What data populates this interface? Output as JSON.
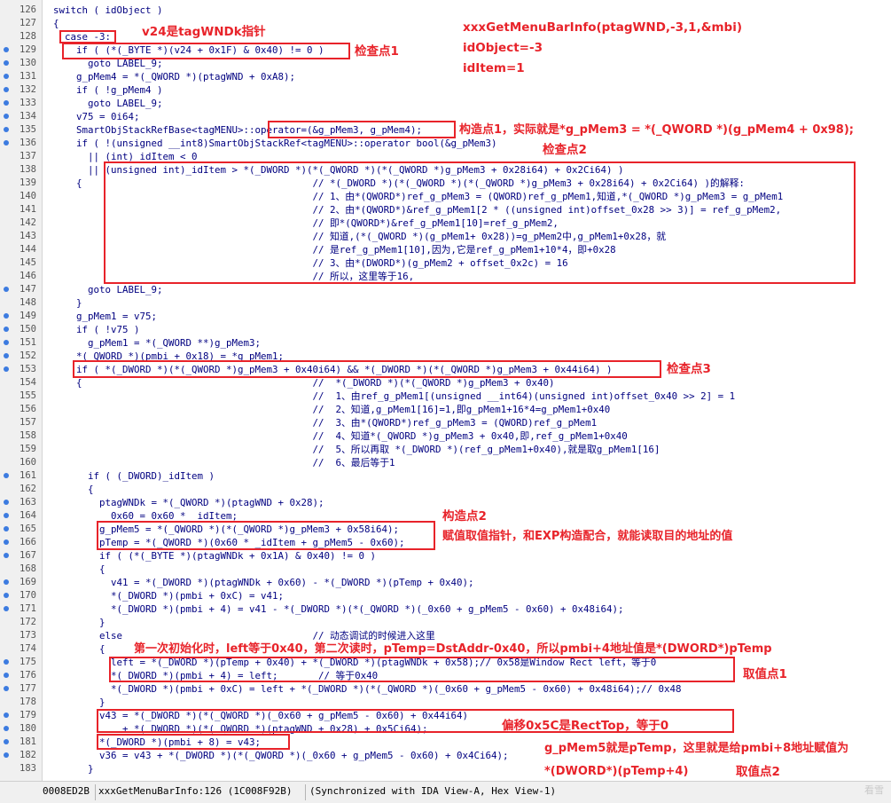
{
  "code_lines": [
    {
      "n": "126",
      "t": "switch ( idObject )"
    },
    {
      "n": "127",
      "t": "{"
    },
    {
      "n": "128",
      "t": "  case -3:"
    },
    {
      "n": "129",
      "dot": true,
      "t": "    if ( (*(_BYTE *)(v24 + 0x1F) & 0x40) != 0 )"
    },
    {
      "n": "130",
      "dot": true,
      "t": "      goto LABEL_9;"
    },
    {
      "n": "131",
      "dot": true,
      "t": "    g_pMem4 = *(_QWORD *)(ptagWND + 0xA8);"
    },
    {
      "n": "132",
      "dot": true,
      "t": "    if ( !g_pMem4 )"
    },
    {
      "n": "133",
      "dot": true,
      "t": "      goto LABEL_9;"
    },
    {
      "n": "134",
      "dot": true,
      "t": "    v75 = 0i64;"
    },
    {
      "n": "135",
      "dot": true,
      "t": "    SmartObjStackRefBase<tagMENU>::operator=(&g_pMem3, g_pMem4);"
    },
    {
      "n": "136",
      "dot": true,
      "t": "    if ( !(unsigned __int8)SmartObjStackRef<tagMENU>::operator bool(&g_pMem3)"
    },
    {
      "n": "137",
      "t": "      || (int)_idItem < 0"
    },
    {
      "n": "138",
      "t": "      || (unsigned int)_idItem > *(_DWORD *)(*(_QWORD *)(*(_QWORD *)g_pMem3 + 0x28i64) + 0x2Ci64) )"
    },
    {
      "n": "139",
      "t": "    {                                        // *(_DWORD *)(*(_QWORD *)(*(_QWORD *)g_pMem3 + 0x28i64) + 0x2Ci64) )的解释:"
    },
    {
      "n": "140",
      "t": "                                             // 1、由*(QWORD*)ref_g_pMem3 = (QWORD)ref_g_pMem1,知道,*(_QWORD *)g_pMem3 = g_pMem1"
    },
    {
      "n": "141",
      "t": "                                             // 2、由*(QWORD*)&ref_g_pMem1[2 * ((unsigned int)offset_0x28 >> 3)] = ref_g_pMem2,"
    },
    {
      "n": "142",
      "t": "                                             // 即*(QWORD*)&ref_g_pMem1[10]=ref_g_pMem2,"
    },
    {
      "n": "143",
      "t": "                                             // 知道,(*(_QWORD *)(g_pMem1+ 0x28))=g_pMem2中,g_pMem1+0x28，就"
    },
    {
      "n": "144",
      "t": "                                             // 是ref_g_pMem1[10],因为,它是ref_g_pMem1+10*4，即+0x28"
    },
    {
      "n": "145",
      "t": "                                             // 3、由*(DWORD*)(g_pMem2 + offset_0x2c) = 16"
    },
    {
      "n": "146",
      "t": "                                             // 所以，这里等于16,"
    },
    {
      "n": "147",
      "dot": true,
      "t": "      goto LABEL_9;"
    },
    {
      "n": "148",
      "t": "    }"
    },
    {
      "n": "149",
      "dot": true,
      "t": "    g_pMem1 = v75;"
    },
    {
      "n": "150",
      "dot": true,
      "t": "    if ( !v75 )"
    },
    {
      "n": "151",
      "dot": true,
      "t": "      g_pMem1 = *(_QWORD **)g_pMem3;"
    },
    {
      "n": "152",
      "dot": true,
      "t": "    *(_QWORD *)(pmbi + 0x18) = *g_pMem1;"
    },
    {
      "n": "153",
      "dot": true,
      "t": "    if ( *(_DWORD *)(*(_QWORD *)g_pMem3 + 0x40i64) && *(_DWORD *)(*(_QWORD *)g_pMem3 + 0x44i64) )"
    },
    {
      "n": "154",
      "t": "    {                                        //  *(_DWORD *)(*(_QWORD *)g_pMem3 + 0x40)"
    },
    {
      "n": "155",
      "t": "                                             //  1、由ref_g_pMem1[(unsigned __int64)(unsigned int)offset_0x40 >> 2] = 1"
    },
    {
      "n": "156",
      "t": "                                             //  2、知道,g_pMem1[16]=1,即g_pMem1+16*4=g_pMem1+0x40"
    },
    {
      "n": "157",
      "t": "                                             //  3、由*(QWORD*)ref_g_pMem3 = (QWORD)ref_g_pMem1"
    },
    {
      "n": "158",
      "t": "                                             //  4、知道*(_QWORD *)g_pMem3 + 0x40,即,ref_g_pMem1+0x40"
    },
    {
      "n": "159",
      "t": "                                             //  5、所以再取 *(_DWORD *)(ref_g_pMem1+0x40),就是取g_pMem1[16]"
    },
    {
      "n": "160",
      "t": "                                             //  6、最后等于1"
    },
    {
      "n": "161",
      "dot": true,
      "t": "      if ( (_DWORD)_idItem )"
    },
    {
      "n": "162",
      "t": "      {"
    },
    {
      "n": "163",
      "dot": true,
      "t": "        ptagWNDk = *(_QWORD *)(ptagWND + 0x28);"
    },
    {
      "n": "164",
      "dot": true,
      "t": "         _0x60 = 0x60 * _idItem;"
    },
    {
      "n": "165",
      "dot": true,
      "t": "        g_pMem5 = *(_QWORD *)(*(_QWORD *)g_pMem3 + 0x58i64);"
    },
    {
      "n": "166",
      "dot": true,
      "t": "        pTemp = *(_QWORD *)(0x60 * _idItem + g_pMem5 - 0x60);"
    },
    {
      "n": "167",
      "dot": true,
      "t": "        if ( (*(_BYTE *)(ptagWNDk + 0x1A) & 0x40) != 0 )"
    },
    {
      "n": "168",
      "t": "        {"
    },
    {
      "n": "169",
      "dot": true,
      "t": "          v41 = *(_DWORD *)(ptagWNDk + 0x60) - *(_DWORD *)(pTemp + 0x40);"
    },
    {
      "n": "170",
      "dot": true,
      "t": "          *(_DWORD *)(pmbi + 0xC) = v41;"
    },
    {
      "n": "171",
      "dot": true,
      "t": "          *(_DWORD *)(pmbi + 4) = v41 - *(_DWORD *)(*(_QWORD *)(_0x60 + g_pMem5 - 0x60) + 0x48i64);"
    },
    {
      "n": "172",
      "t": "        }"
    },
    {
      "n": "173",
      "t": "        else                                 // 动态调试的时候进入这里"
    },
    {
      "n": "174",
      "t": "        {"
    },
    {
      "n": "175",
      "dot": true,
      "t": "          left = *(_DWORD *)(pTemp + 0x40) + *(_DWORD *)(ptagWNDk + 0x58);// 0x58是Window Rect left，等于0"
    },
    {
      "n": "176",
      "dot": true,
      "t": "          *(_DWORD *)(pmbi + 4) = left;       // 等于0x40"
    },
    {
      "n": "177",
      "dot": true,
      "t": "          *(_DWORD *)(pmbi + 0xC) = left + *(_DWORD *)(*(_QWORD *)(_0x60 + g_pMem5 - 0x60) + 0x48i64);// 0x48"
    },
    {
      "n": "178",
      "t": "        }"
    },
    {
      "n": "179",
      "dot": true,
      "t": "        v43 = *(_DWORD *)(*(_QWORD *)(_0x60 + g_pMem5 - 0x60) + 0x44i64)"
    },
    {
      "n": "180",
      "dot": true,
      "t": "            + *(_DWORD *)(*(_QWORD *)(ptagWND + 0x28) + 0x5Ci64);"
    },
    {
      "n": "181",
      "dot": true,
      "t": "        *(_DWORD *)(pmbi + 8) = v43;"
    },
    {
      "n": "182",
      "dot": true,
      "t": "        v36 = v43 + *(_DWORD *)(*(_QWORD *)(_0x60 + g_pMem5 - 0x60) + 0x4Ci64);"
    },
    {
      "n": "183",
      "t": "      }"
    }
  ],
  "annotations": {
    "title_call": "xxxGetMenuBarInfo(ptagWND,-3,1,&mbi)",
    "id_object": "idObject=-3",
    "id_item": "idItem=1",
    "v24_note": "v24是tagWNDk指针",
    "check1": "检查点1",
    "construct1": "构造点1，实际就是*g_pMem3 = *(_QWORD *)(g_pMem4 + 0x98);",
    "check2": "检查点2",
    "check3": "检查点3",
    "construct2": "构造点2",
    "construct2_desc": "赋值取值指针，和EXP构造配合，就能读取目的地址的值",
    "first_init": "第一次初始化时，left等于0x40，第二次读时，pTemp=DstAddr-0x40，所以pmbi+4地址值是*(DWORD*)pTemp",
    "take1": "取值点1",
    "offset_note": "偏移0x5C是RectTop，等于0",
    "pmem5_note": "g_pMem5就是pTemp，这里就是给pmbi+8地址赋值为",
    "dword_note": "*(DWORD*)(pTemp+4)",
    "take2": "取值点2"
  },
  "status_bar": {
    "address": "0008ED2B",
    "location": "xxxGetMenuBarInfo:126 (1C008F92B)",
    "sync": "(Synchronized with IDA View-A, Hex View-1)"
  },
  "watermark": "看雪"
}
